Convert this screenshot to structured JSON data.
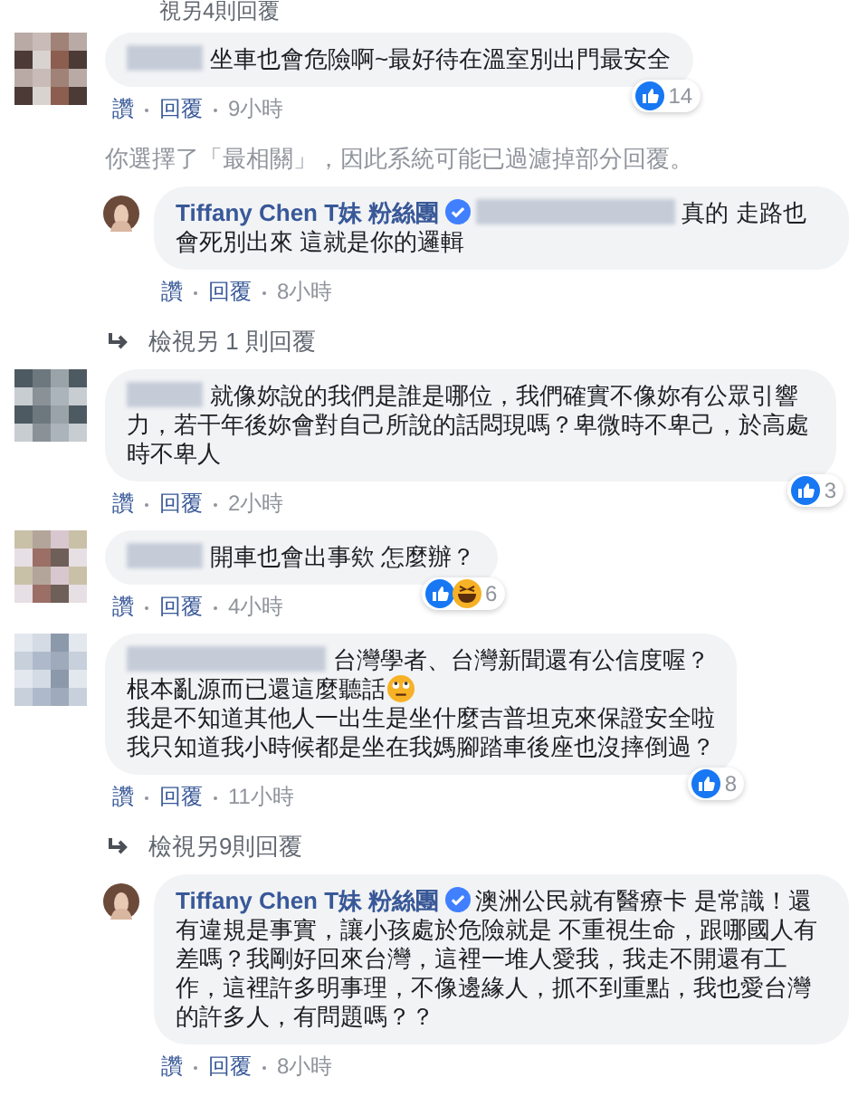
{
  "top_link": "視另4則回覆",
  "items": [
    {
      "kind": "comment",
      "lines": [
        {
          "text": "坐車也會危險啊~最好待在溫室別出門最安全"
        }
      ],
      "reactions": [
        {
          "kind": "like"
        }
      ],
      "count": "14",
      "actions": [
        "讚",
        "回覆",
        "9小時"
      ]
    },
    {
      "kind": "notice",
      "text": "你選擇了「最相關」，因此系統可能已過濾掉部分回覆。"
    },
    {
      "kind": "reply",
      "author": "Tiffany Chen T妹 粉絲團",
      "verified": true,
      "mention": true,
      "text": "真的 走路也會死別出來 這就是你的邏輯",
      "actions": [
        "讚",
        "回覆",
        "8小時"
      ]
    },
    {
      "kind": "more",
      "text": "檢視另 1 則回覆"
    },
    {
      "kind": "comment",
      "lines": [
        {
          "text": "就像妳說的我們是誰是哪位，我們確實不像妳有公眾引響力，若干年後妳會對自己所說的話悶現嗎？卑微時不卑己，於高處時不卑人"
        }
      ],
      "reactions": [
        {
          "kind": "like"
        }
      ],
      "count": "3",
      "actions": [
        "讚",
        "回覆",
        "2小時"
      ]
    },
    {
      "kind": "comment",
      "lines": [
        {
          "text": "開車也會出事欸 怎麼辦？"
        }
      ],
      "reactions": [
        {
          "kind": "like"
        },
        {
          "kind": "haha"
        }
      ],
      "count": "6",
      "actions": [
        "讚",
        "回覆",
        "4小時"
      ]
    },
    {
      "kind": "comment",
      "lines": [
        {
          "text": "台灣學者、台灣新聞還有公信度喔？"
        },
        {
          "text": "根本亂源而已還這麼聽話",
          "trailing_emoji": true
        },
        {
          "text": "我是不知道其他人一出生是坐什麼吉普坦克來保證安全啦"
        },
        {
          "text": "我只知道我小時候都是坐在我媽腳踏車後座也沒摔倒過？"
        }
      ],
      "reactions": [
        {
          "kind": "like"
        }
      ],
      "count": "8",
      "actions": [
        "讚",
        "回覆",
        "11小時"
      ],
      "long_name": true
    },
    {
      "kind": "more",
      "text": "檢視另9則回覆"
    },
    {
      "kind": "reply",
      "author": "Tiffany Chen T妹 粉絲團",
      "verified": true,
      "text": "澳洲公民就有醫療卡 是常識！還有違規是事實，讓小孩處於危險就是 不重視生命，跟哪國人有差嗎？我剛好回來台灣，這裡一堆人愛我，我走不開還有工作，這裡許多明事理，不像邊緣人，抓不到重點，我也愛台灣的許多人，有問題嗎？？",
      "actions": [
        "讚",
        "回覆",
        "8小時"
      ]
    }
  ]
}
